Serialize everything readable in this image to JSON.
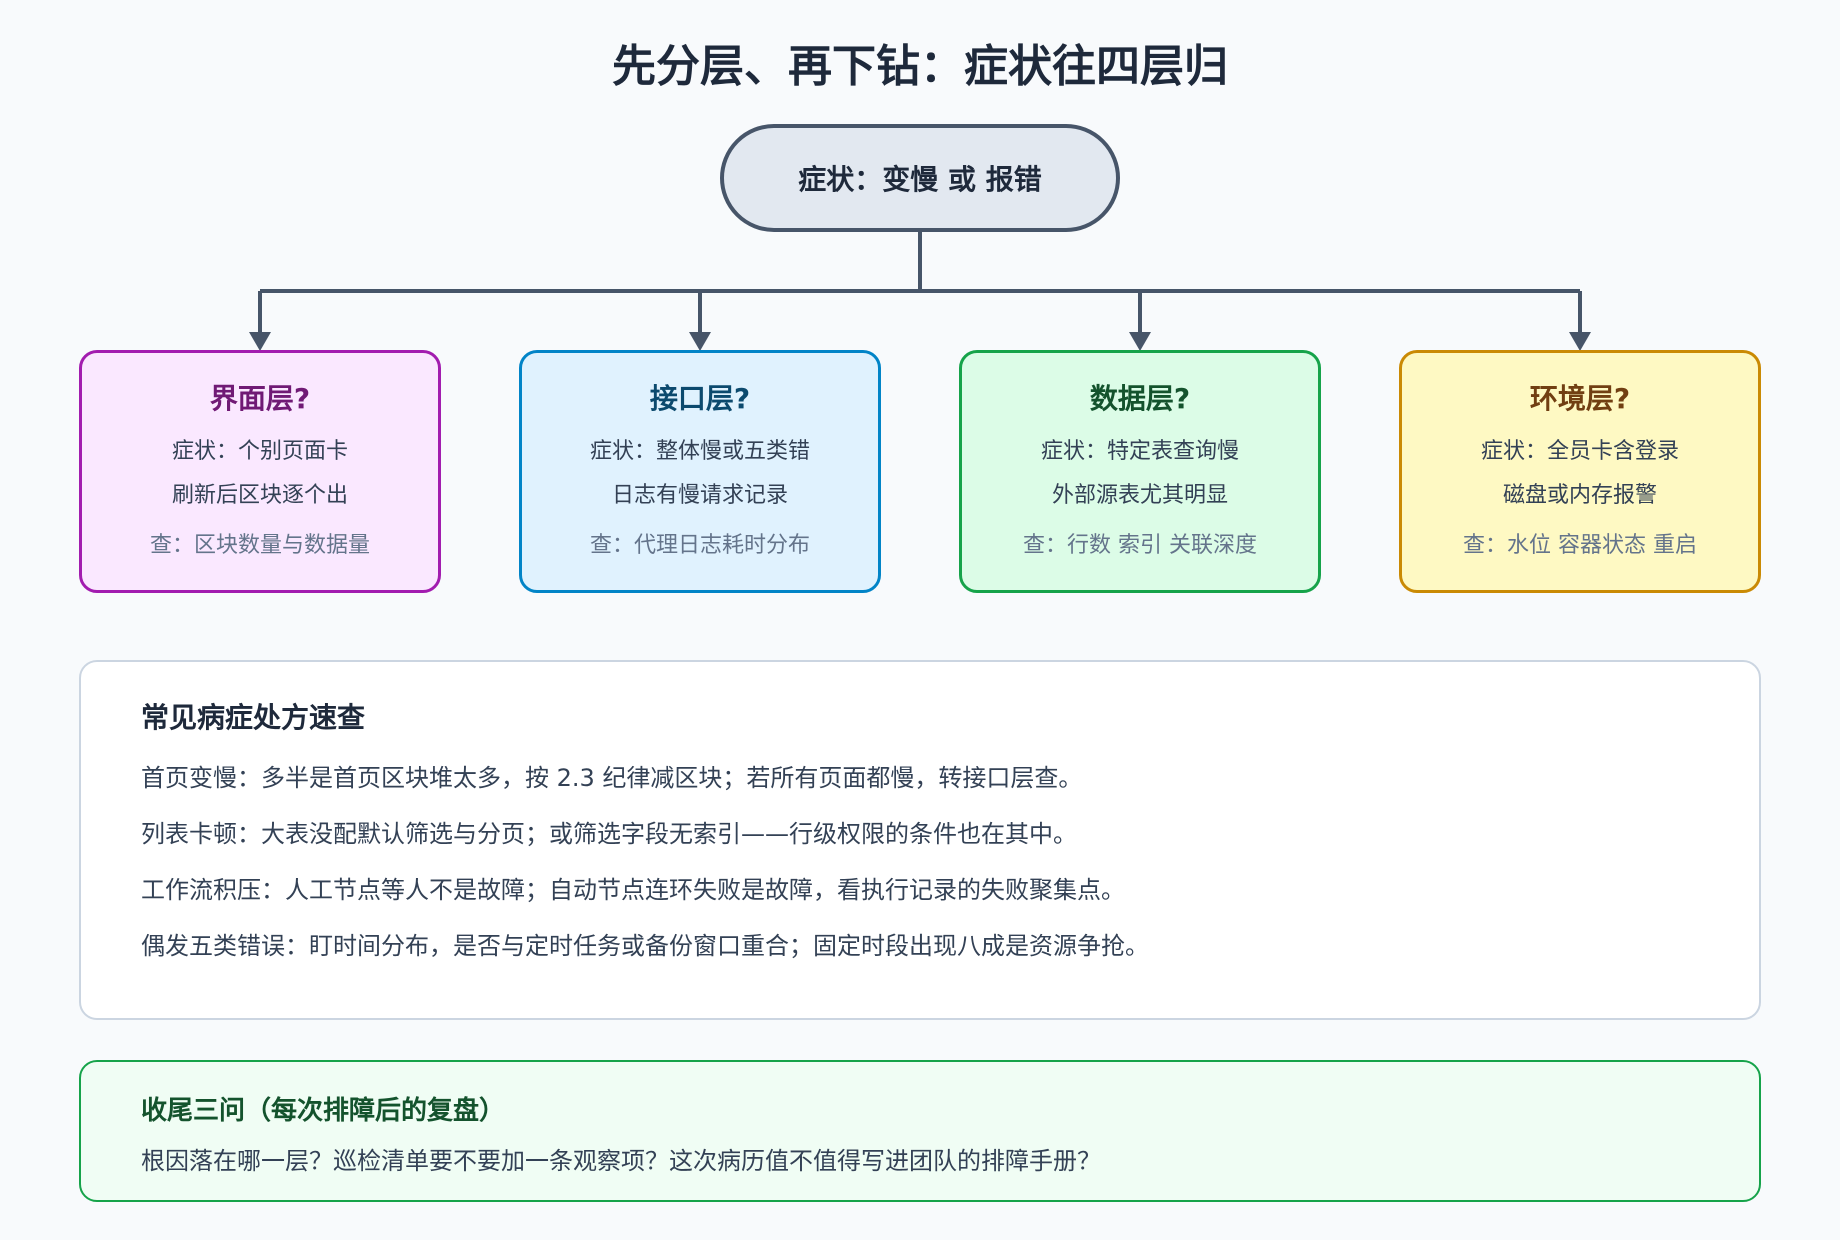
{
  "title": "先分层、再下钻：症状往四层归",
  "root": {
    "label": "症状：变慢 或 报错"
  },
  "layers": [
    {
      "name": "界面层?",
      "symptom1": "症状：个别页面卡",
      "symptom2": "刷新后区块逐个出",
      "check": "查：区块数量与数据量",
      "accent": "#a21caf"
    },
    {
      "name": "接口层?",
      "symptom1": "症状：整体慢或五类错",
      "symptom2": "日志有慢请求记录",
      "check": "查：代理日志耗时分布",
      "accent": "#0284c7"
    },
    {
      "name": "数据层?",
      "symptom1": "症状：特定表查询慢",
      "symptom2": "外部源表尤其明显",
      "check": "查：行数 索引 关联深度",
      "accent": "#16a34a"
    },
    {
      "name": "环境层?",
      "symptom1": "症状：全员卡含登录",
      "symptom2": "磁盘或内存报警",
      "check": "查：水位 容器状态 重启",
      "accent": "#ca8a04"
    }
  ],
  "prescriptions": {
    "title": "常见病症处方速查",
    "lines": [
      "首页变慢：多半是首页区块堆太多，按 2.3 纪律减区块；若所有页面都慢，转接口层查。",
      "列表卡顿：大表没配默认筛选与分页；或筛选字段无索引——行级权限的条件也在其中。",
      "工作流积压：人工节点等人不是故障；自动节点连环失败是故障，看执行记录的失败聚集点。",
      "偶发五类错误：盯时间分布，是否与定时任务或备份窗口重合；固定时段出现八成是资源争抢。"
    ]
  },
  "wrapup": {
    "title": "收尾三问（每次排障后的复盘）",
    "text": "根因落在哪一层？巡检清单要不要加一条观察项？这次病历值不值得写进团队的排障手册？"
  }
}
